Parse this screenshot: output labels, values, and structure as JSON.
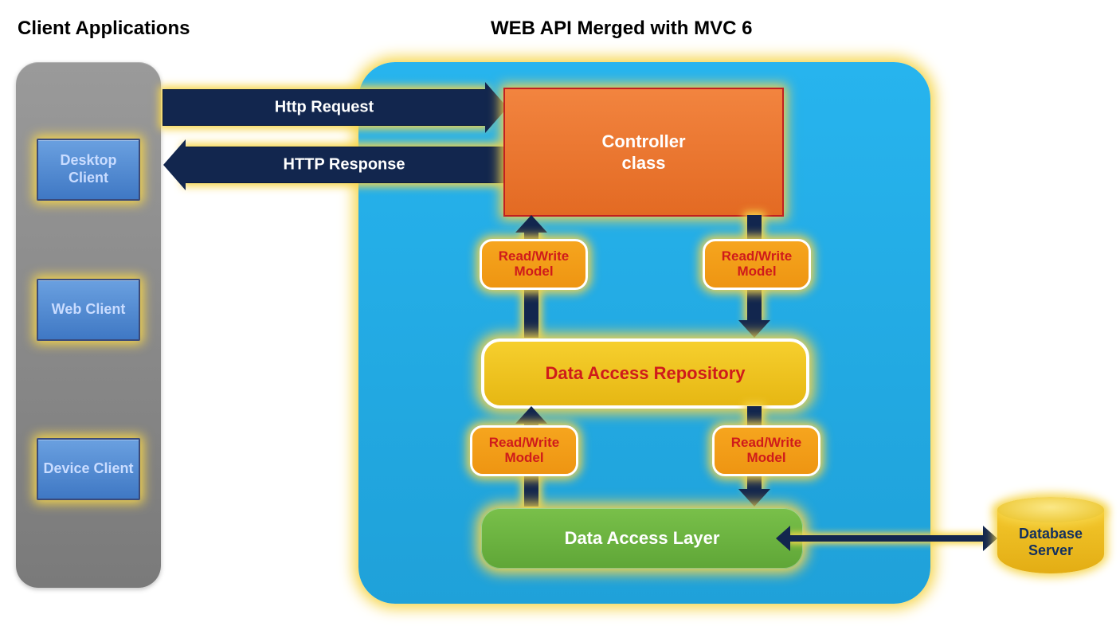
{
  "headings": {
    "clients": "Client Applications",
    "api": "WEB API Merged with MVC 6"
  },
  "clients": {
    "desktop": "Desktop Client",
    "web": "Web Client",
    "device": "Device Client"
  },
  "arrows": {
    "request": "Http Request",
    "response": "HTTP Response"
  },
  "apiBoxes": {
    "controller": "Controller\nclass",
    "repository": "Data Access Repository",
    "dal": "Data Access Layer"
  },
  "pill": "Read/Write Model",
  "database": "Database Server"
}
